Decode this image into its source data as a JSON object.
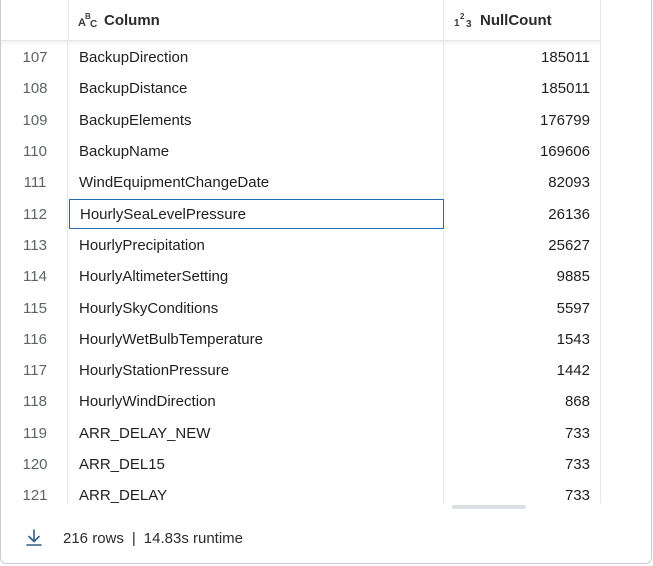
{
  "columns": {
    "column_header": "Column",
    "column_type_icon": "abc-text-type-icon",
    "nullcount_header": "NullCount",
    "nullcount_type_icon": "123-number-type-icon"
  },
  "rows": [
    {
      "index": "107",
      "column": "BackupDirection",
      "nullcount": "185011"
    },
    {
      "index": "108",
      "column": "BackupDistance",
      "nullcount": "185011"
    },
    {
      "index": "109",
      "column": "BackupElements",
      "nullcount": "176799"
    },
    {
      "index": "110",
      "column": "BackupName",
      "nullcount": "169606"
    },
    {
      "index": "111",
      "column": "WindEquipmentChangeDate",
      "nullcount": "82093"
    },
    {
      "index": "112",
      "column": "HourlySeaLevelPressure",
      "nullcount": "26136",
      "selected": true
    },
    {
      "index": "113",
      "column": "HourlyPrecipitation",
      "nullcount": "25627"
    },
    {
      "index": "114",
      "column": "HourlyAltimeterSetting",
      "nullcount": "9885"
    },
    {
      "index": "115",
      "column": "HourlySkyConditions",
      "nullcount": "5597"
    },
    {
      "index": "116",
      "column": "HourlyWetBulbTemperature",
      "nullcount": "1543"
    },
    {
      "index": "117",
      "column": "HourlyStationPressure",
      "nullcount": "1442"
    },
    {
      "index": "118",
      "column": "HourlyWindDirection",
      "nullcount": "868"
    },
    {
      "index": "119",
      "column": "ARR_DELAY_NEW",
      "nullcount": "733"
    },
    {
      "index": "120",
      "column": "ARR_DEL15",
      "nullcount": "733"
    },
    {
      "index": "121",
      "column": "ARR_DELAY",
      "nullcount": "733"
    }
  ],
  "footer": {
    "download_icon": "download-icon",
    "row_count": "216 rows",
    "separator": "|",
    "runtime": "14.83s runtime"
  },
  "colors": {
    "selection_border": "#1f6fb2",
    "grid_line": "#e3e6ea",
    "index_text": "#5f6368"
  }
}
